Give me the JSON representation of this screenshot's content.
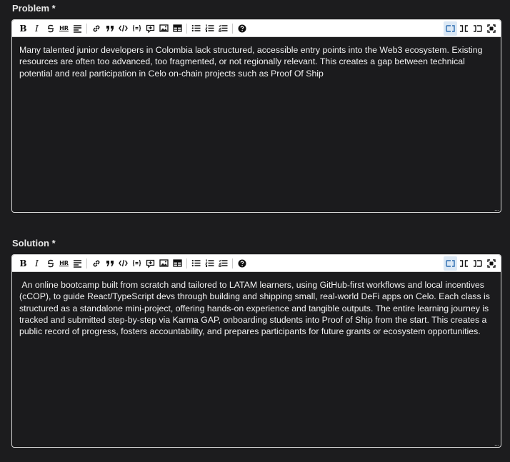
{
  "problem": {
    "label": "Problem *",
    "text": "Many talented junior developers in Colombia lack structured, accessible entry points into the Web3 ecosystem. Existing resources are often too advanced, too fragmented, or not regionally relevant. This creates a gap between technical potential and real participation in Celo on-chain projects such as Proof Of Ship"
  },
  "solution": {
    "label": "Solution *",
    "text": " An online bootcamp built from scratch and tailored to LATAM learners, using GitHub-first workflows and local incentives (cCOP), to guide React/TypeScript devs through building and shipping small, real-world DeFi apps on Celo. Each class is structured as a standalone mini-project, offering hands-on experience and tangible outputs. The entire learning journey is tracked and submitted step-by-step via Karma GAP, onboarding students into Proof of Ship from the start. This creates a public record of progress, fosters accountability, and prepares participants for future grants or ecosystem opportunities."
  },
  "toolbar": {
    "bold": "B",
    "italic": "I",
    "hr": "HR",
    "resize_handle": "..."
  },
  "icons": [
    "bold-icon",
    "italic-icon",
    "strikethrough-icon",
    "horizontal-rule-icon",
    "heading-icon",
    "link-icon",
    "quote-icon",
    "code-icon",
    "code-block-icon",
    "comment-icon",
    "image-icon",
    "table-icon",
    "unordered-list-icon",
    "ordered-list-icon",
    "checklist-icon",
    "help-icon",
    "edit-mode-icon",
    "split-mode-icon",
    "preview-mode-icon",
    "fullscreen-icon"
  ]
}
